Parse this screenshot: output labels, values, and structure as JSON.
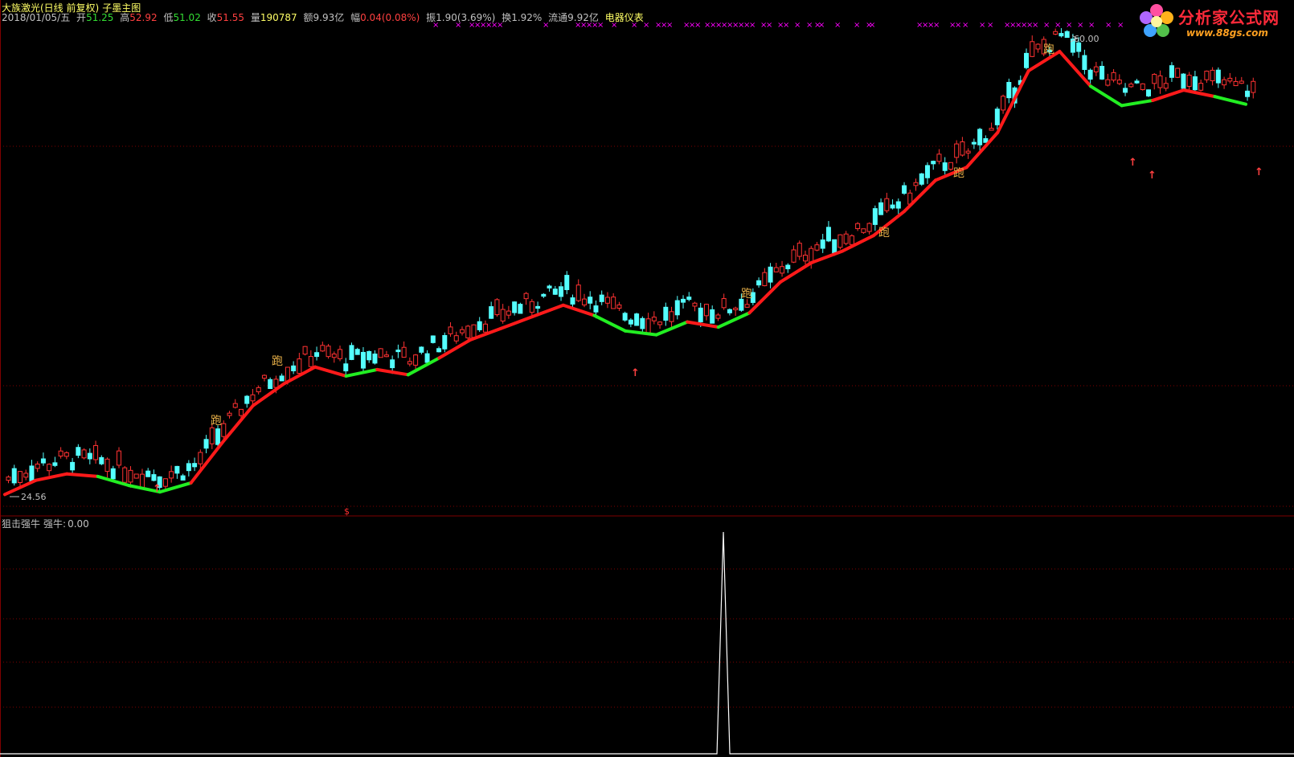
{
  "header": {
    "stock": "大族激光(日线 前复权)",
    "template": "子墨主图",
    "date": "2018/01/05/五",
    "open_label": "开",
    "open": "51.25",
    "high_label": "高",
    "high": "52.92",
    "low_label": "低",
    "low": "51.02",
    "close_label": "收",
    "close": "51.55",
    "vol_label": "量",
    "vol": "190787",
    "amt_label": "额",
    "amt": "9.93亿",
    "chg_label": "幅",
    "chg": "0.04(0.08%)",
    "amp_label": "振",
    "amp": "1.90(3.69%)",
    "turn_label": "换",
    "turn": "1.92%",
    "float_label": "流通",
    "float": "9.92亿",
    "industry": "电器仪表"
  },
  "logo": {
    "text": "分析家公式网",
    "url": "www.88gs.com"
  },
  "sub_header": {
    "indicator": "狙击强牛",
    "series": "强牛:",
    "value": "0.00"
  },
  "colors": {
    "up": "#ff3232",
    "down": "#54ffff",
    "ma_up": "#ff1a1a",
    "ma_down": "#22ee22",
    "grid": "#800000",
    "text": "#c0c0c0",
    "cross": "#ff00ff",
    "spike": "#ffffff",
    "runner": "#e8b048"
  },
  "chart_data": {
    "type": "candlestick",
    "markers": {
      "max_label": "60.00",
      "min_label": "24.56",
      "s_label": "$"
    },
    "price_max": 60.0,
    "price_min": 24.56,
    "ma_series": [
      24.6,
      25.7,
      26.2,
      26.0,
      25.3,
      24.8,
      25.5,
      28.6,
      31.5,
      33.2,
      34.5,
      33.8,
      34.3,
      33.9,
      35.2,
      36.6,
      37.5,
      38.4,
      39.3,
      38.5,
      37.3,
      37.0,
      38.0,
      37.6,
      38.7,
      41.1,
      42.6,
      43.5,
      44.7,
      46.6,
      49.0,
      50.0,
      52.7,
      57.5,
      59.0,
      56.3,
      54.8,
      55.2,
      56.0,
      55.5,
      54.9
    ],
    "ma_trend": [
      "up",
      "up",
      "up",
      "down",
      "down",
      "down",
      "up",
      "up",
      "up",
      "up",
      "up",
      "down",
      "up",
      "down",
      "up",
      "up",
      "up",
      "up",
      "up",
      "down",
      "down",
      "down",
      "up",
      "down",
      "up",
      "up",
      "up",
      "up",
      "up",
      "up",
      "up",
      "up",
      "up",
      "up",
      "up",
      "down",
      "down",
      "up",
      "up",
      "down",
      "down"
    ],
    "candle_count": 215,
    "runner_label": "跑",
    "arrow_label": "↑",
    "subchart": {
      "type": "line",
      "name": "强牛",
      "spike_at_fraction": 0.568,
      "values_max": 1,
      "value": 0.0
    }
  }
}
